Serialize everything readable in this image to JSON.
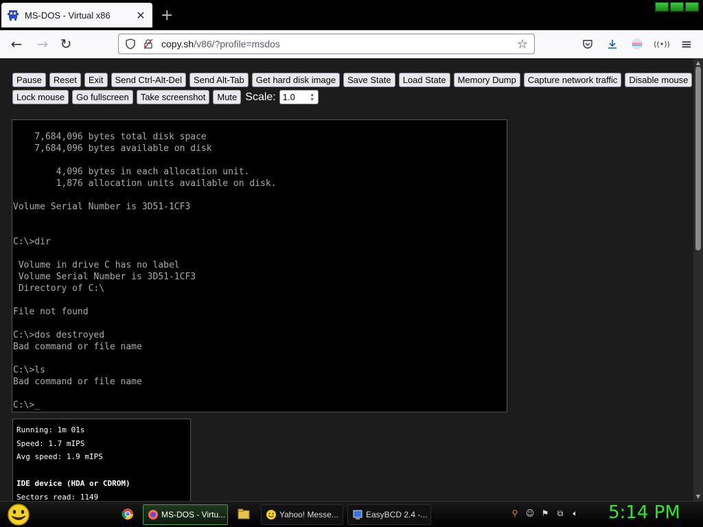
{
  "browser": {
    "tab_title": "MS-DOS - Virtual x86",
    "new_tab": "+",
    "url_host": "copy.sh",
    "url_path": "/v86/?profile=msdos"
  },
  "controls": {
    "row1": [
      "Pause",
      "Reset",
      "Exit",
      "Send Ctrl-Alt-Del",
      "Send Alt-Tab",
      "Get hard disk image",
      "Save State",
      "Load State",
      "Memory Dump",
      "Capture network traffic",
      "Disable mouse"
    ],
    "row2": [
      "Lock mouse",
      "Go fullscreen",
      "Take screenshot",
      "Mute"
    ],
    "scale_label": "Scale:",
    "scale_value": "1.0"
  },
  "terminal": {
    "lines": [
      "    7,684,096 bytes total disk space",
      "    7,684,096 bytes available on disk",
      "",
      "        4,096 bytes in each allocation unit.",
      "        1,876 allocation units available on disk.",
      "",
      "Volume Serial Number is 3D51-1CF3",
      "",
      "",
      "C:\\>dir",
      "",
      " Volume in drive C has no label",
      " Volume Serial Number is 3D51-1CF3",
      " Directory of C:\\",
      "",
      "File not found",
      "",
      "C:\\>dos destroyed",
      "Bad command or file name",
      "",
      "C:\\>ls",
      "Bad command or file name",
      "",
      "C:\\>_"
    ]
  },
  "stats": {
    "running": "Running: 1m 01s",
    "speed": "Speed: 1.7 mIPS",
    "avg_speed": "Avg speed: 1.9 mIPS",
    "ide_header": "IDE device (HDA or CDROM)",
    "sectors_read": "Sectors read: 1149"
  },
  "taskbar": {
    "items": [
      "MS-DOS - Virtu...",
      "Yahoo! Messe...",
      "EasyBCD 2.4 -..."
    ],
    "clock": "5:14 PM"
  },
  "colors": {
    "clock": "#2ee62e",
    "terminal_text": "#ababab",
    "active_task_border": "#3aa33a"
  }
}
